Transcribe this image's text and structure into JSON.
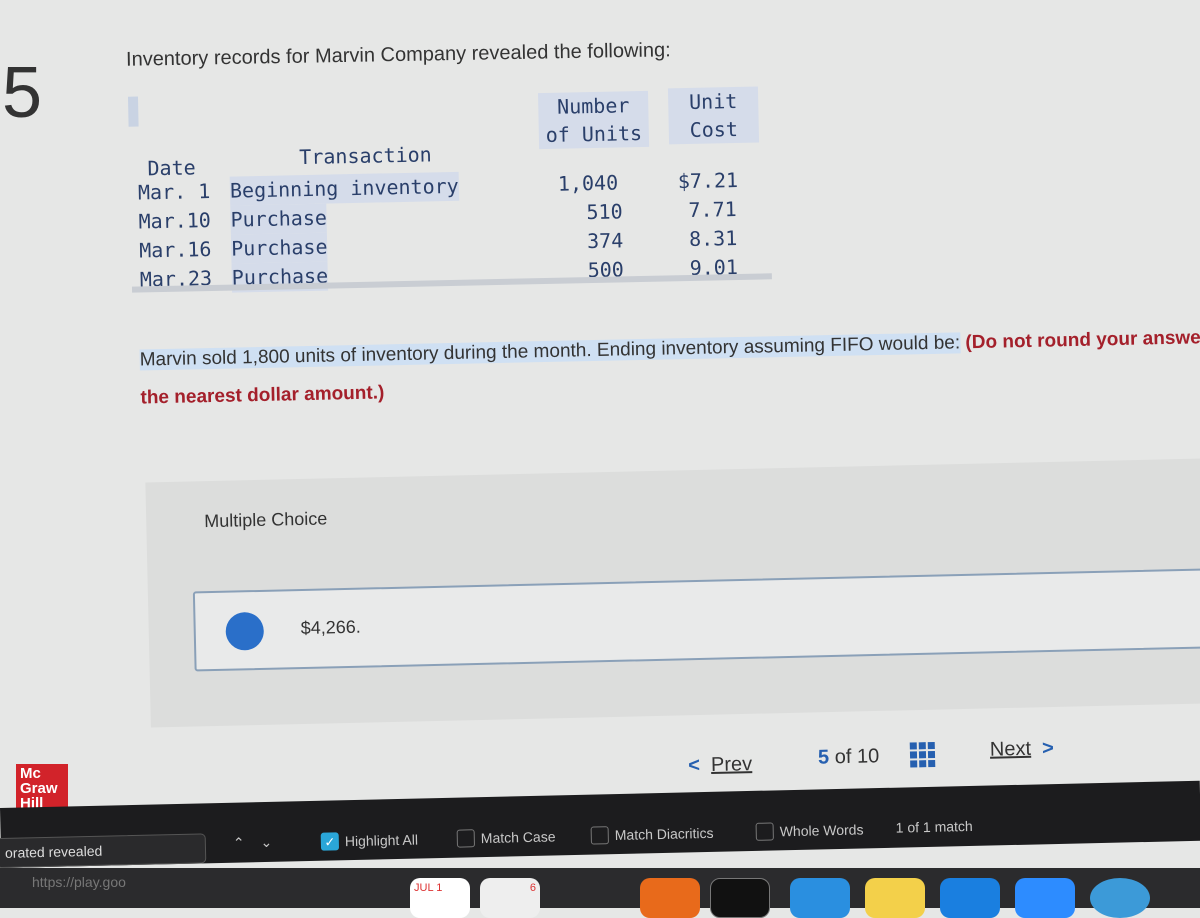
{
  "question_number": "5",
  "intro": "Inventory records for Marvin Company revealed the following:",
  "table": {
    "headers": {
      "date": "Date",
      "transaction": "Transaction",
      "units_line1": "Number",
      "units_line2": "of Units",
      "cost_line1": "Unit",
      "cost_line2": "Cost"
    },
    "rows": [
      {
        "date": "Mar. 1",
        "transaction": "Beginning inventory",
        "units": "1,040",
        "cost": "$7.21"
      },
      {
        "date": "Mar.10",
        "transaction": "Purchase",
        "units": "510",
        "cost": "7.71"
      },
      {
        "date": "Mar.16",
        "transaction": "Purchase",
        "units": "374",
        "cost": "8.31"
      },
      {
        "date": "Mar.23",
        "transaction": "Purchase",
        "units": "500",
        "cost": "9.01"
      }
    ]
  },
  "question": {
    "text": "Marvin sold 1,800 units of inventory during the month. Ending inventory assuming FIFO would be:",
    "note": "(Do not round your answer to the nearest dollar amount.)"
  },
  "multiple_choice": {
    "label": "Multiple Choice",
    "options": [
      {
        "text": "$4,266.",
        "selected": true
      }
    ]
  },
  "logo": {
    "line1": "Mc",
    "line2": "Graw",
    "line3": "Hill"
  },
  "nav": {
    "prev": "Prev",
    "current": "5",
    "of": "of 10",
    "next": "Next"
  },
  "findbar": {
    "input": "orated revealed",
    "highlight_all": "Highlight All",
    "highlight_all_checked": true,
    "match_case": "Match Case",
    "match_diacritics": "Match Diacritics",
    "whole_words": "Whole Words",
    "match_count": "1 of 1 match"
  },
  "dock": {
    "url": "https://play.goo",
    "calendar_month": "JUL",
    "calendar_badge": "1",
    "reminders_badge": "6"
  }
}
